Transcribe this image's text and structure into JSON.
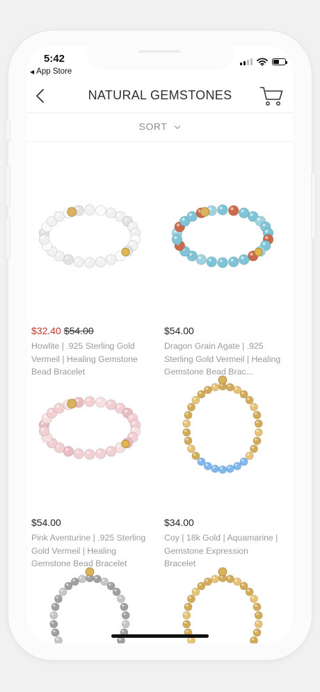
{
  "status": {
    "time": "5:42",
    "back_app": "App Store"
  },
  "header": {
    "title": "NATURAL GEMSTONES",
    "back_icon": "chevron-left-icon",
    "cart_icon": "cart-icon"
  },
  "sort": {
    "label": "SORT"
  },
  "products": [
    {
      "price": "$32.40",
      "original_price": "$54.00",
      "name": "Howlite | .925 Sterling Gold Vermeil | Healing Gemstone Bead Bracelet",
      "colors": [
        "#f1f1f1",
        "#e3e3e3",
        "#fafafa"
      ]
    },
    {
      "price": "$54.00",
      "original_price": "",
      "name": "Dragon Grain Agate | .925 Sterling Gold Vermeil | Healing Gemstone Bead Brac...",
      "colors": [
        "#7ec4d6",
        "#9fd3e0",
        "#c96a4d"
      ]
    },
    {
      "price": "$54.00",
      "original_price": "",
      "name": "Pink Aventurine | .925 Sterling Gold Vermeil | Healing Gemstone Bead Bracelet",
      "colors": [
        "#f2cfd2",
        "#e9bcc1",
        "#f7dfe1"
      ]
    },
    {
      "price": "$34.00",
      "original_price": "",
      "name": "Coy | 18k Gold | Aquamarine | Gemstone Expression Bracelet",
      "colors": [
        "#d3aa55",
        "#7fb8ee",
        "#e6c375"
      ]
    },
    {
      "price": "",
      "original_price": "",
      "name": "",
      "colors": [
        "#9ea0a3",
        "#5b3fa8",
        "#c4c6c8"
      ]
    },
    {
      "price": "",
      "original_price": "",
      "name": "",
      "colors": [
        "#d3aa55",
        "#8fd6c2",
        "#e6c375"
      ]
    }
  ]
}
